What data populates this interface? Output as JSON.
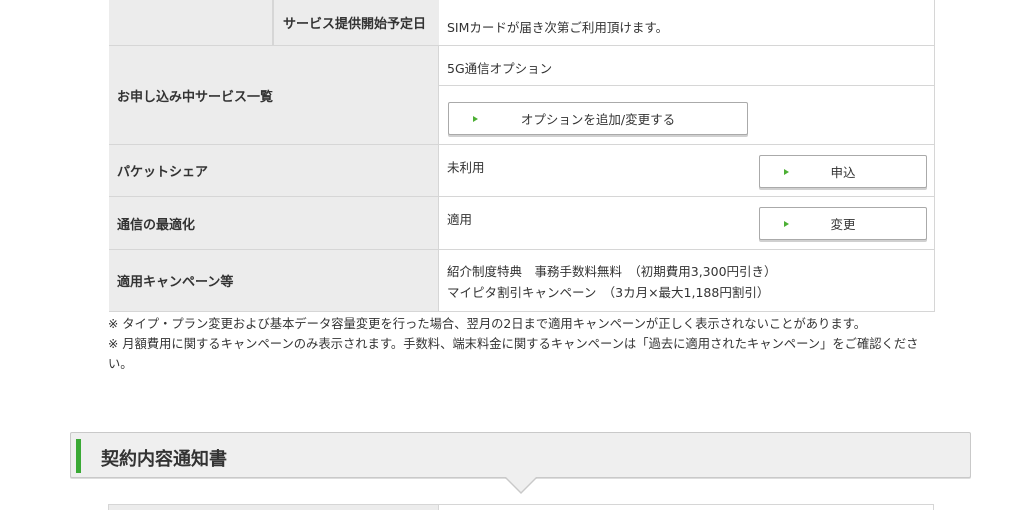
{
  "table": {
    "start_date": {
      "label": "サービス提供開始予定日",
      "value": "SIMカードが届き次第ご利用頂けます。"
    },
    "services": {
      "label": "お申し込み中サービス一覧",
      "value": "5G通信オプション",
      "button": "オプションを追加/変更する"
    },
    "packet_share": {
      "label": "パケットシェア",
      "value": "未利用",
      "button": "申込"
    },
    "optimization": {
      "label": "通信の最適化",
      "value": "適用",
      "button": "変更"
    },
    "campaign": {
      "label": "適用キャンペーン等",
      "line1": "紹介制度特典　事務手数料無料　（初期費用3,300円引き）",
      "line2": "マイピタ割引キャンペーン　（3カ月×最大1,188円割引）"
    }
  },
  "notes": [
    "※ タイプ・プラン変更および基本データ容量変更を行った場合、翌月の2日まで適用キャンペーンが正しく表示されないことがあります。",
    "※ 月額費用に関するキャンペーンのみ表示されます。手数料、端末料金に関するキャンペーンは「過去に適用されたキャンペーン」をご確認ください。"
  ],
  "section": {
    "title": "契約内容通知書"
  },
  "colors": {
    "accent": "#3aa935",
    "header_bg": "#ececec",
    "border": "#d6d6d6"
  }
}
